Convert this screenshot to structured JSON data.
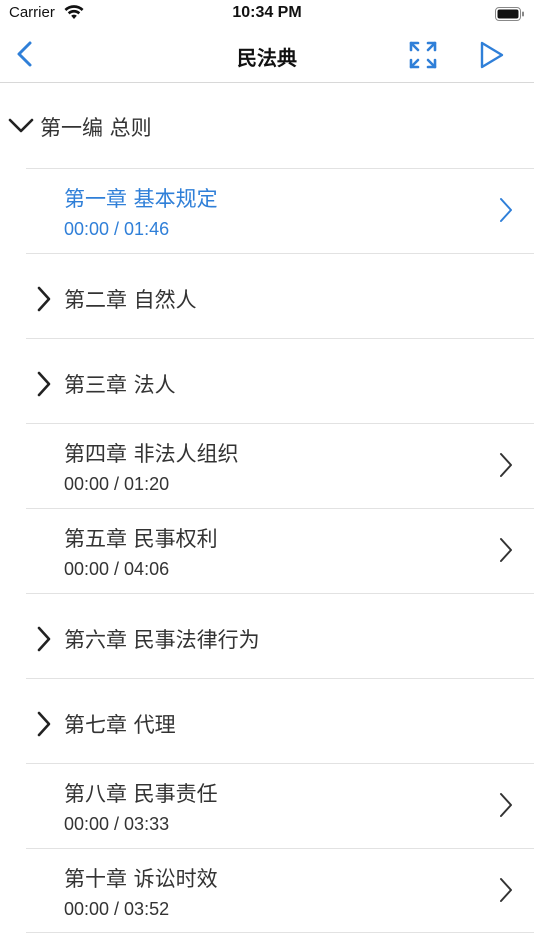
{
  "status_bar": {
    "carrier": "Carrier",
    "time": "10:34 PM"
  },
  "nav": {
    "title": "民法典",
    "back_icon": "chevron-left-icon",
    "expand_icon": "expand-arrows-icon",
    "play_icon": "play-icon",
    "accent": "#2f7fd8"
  },
  "section": {
    "label": "第一编 总则",
    "expanded": true
  },
  "rows": [
    {
      "type": "sub",
      "title": "第一章 基本规定",
      "time": "00:00 / 01:46",
      "active": true
    },
    {
      "type": "group",
      "title": "第二章 自然人"
    },
    {
      "type": "group",
      "title": "第三章 法人"
    },
    {
      "type": "sub",
      "title": "第四章 非法人组织",
      "time": "00:00 / 01:20"
    },
    {
      "type": "sub",
      "title": "第五章 民事权利",
      "time": "00:00 / 04:06"
    },
    {
      "type": "group",
      "title": "第六章 民事法律行为"
    },
    {
      "type": "group",
      "title": "第七章 代理"
    },
    {
      "type": "sub",
      "title": "第八章 民事责任",
      "time": "00:00 / 03:33"
    },
    {
      "type": "sub",
      "title": "第十章 诉讼时效",
      "time": "00:00 / 03:52"
    }
  ]
}
